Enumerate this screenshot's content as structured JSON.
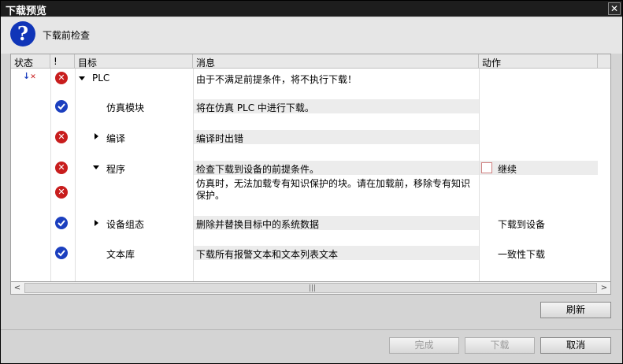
{
  "window": {
    "title": "下载预览",
    "close_glyph": "✕"
  },
  "header": {
    "icon": "help-icon",
    "title": "下载前检查"
  },
  "columns": {
    "status": "状态",
    "flag": "!",
    "target": "目标",
    "message": "消息",
    "action": "动作"
  },
  "rows": [
    {
      "target": "PLC",
      "message": "由于不满足前提条件，将不执行下载！",
      "action": ""
    },
    {
      "target": "仿真模块",
      "message": "将在仿真 PLC 中进行下载。",
      "action": ""
    },
    {
      "target": "编译",
      "message": "编译时出错",
      "action": ""
    },
    {
      "target": "程序",
      "message": "检查下载到设备的前提条件。",
      "action": "继续"
    },
    {
      "target": "",
      "message_line1": "仿真时，无法加载专有知识保护的块。请在加载前，移除专有知识",
      "message_line2": "保护。",
      "action": ""
    },
    {
      "target": "设备组态",
      "message": "删除并替换目标中的系统数据",
      "action": "下载到设备"
    },
    {
      "target": "文本库",
      "message": "下载所有报警文本和文本列表文本",
      "action": "一致性下载"
    }
  ],
  "scrollbar": {
    "left": "<",
    "right": ">",
    "grip": "|||"
  },
  "buttons": {
    "refresh": "刷新",
    "finish": "完成",
    "load": "下载",
    "cancel": "取消"
  },
  "colors": {
    "error": "#c81d1d",
    "ok": "#1b3fbf",
    "titlebar": "#1d1d1d"
  }
}
